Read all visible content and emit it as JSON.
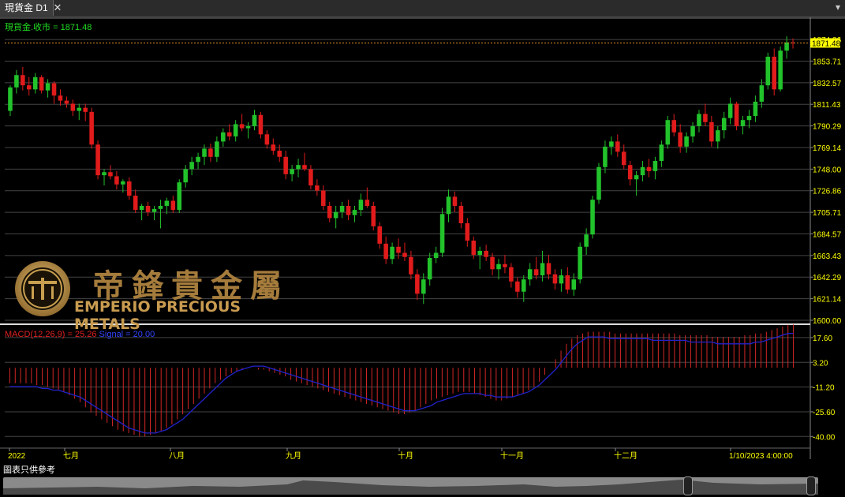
{
  "tab": {
    "title": "現貨金 D1",
    "close": "✕",
    "menu": "▾"
  },
  "legend": {
    "price": "現貨金.收市 = 1871.48",
    "macd": "MACD(12,26,9) = 25.26",
    "signal": "Signal = 20.00"
  },
  "logo": {
    "cn": "帝鋒貴金屬",
    "en": "EMPERIO PRECIOUS METALS"
  },
  "disclaimer": "圖表只供參考",
  "colors": {
    "up": "#22c22b",
    "down": "#e11b1b",
    "grid": "#444444",
    "axis_text": "#ffff00",
    "legend_price": "#22dd22",
    "macd_hist": "#d42626",
    "signal": "#2222cc",
    "last_price_line": "#e8902a"
  },
  "chart_data": [
    {
      "type": "candlestick",
      "title": "現貨金 D1",
      "ylim": [
        1600.0,
        1878.0
      ],
      "y_ticks": [
        "1874.86",
        "1853.71",
        "1832.57",
        "1811.43",
        "1790.29",
        "1769.14",
        "1748.00",
        "1726.86",
        "1705.71",
        "1684.57",
        "1663.43",
        "1642.29",
        "1621.14",
        "1600.00"
      ],
      "last_price": "1871.48",
      "x_labels": [
        "2022",
        "七月",
        "八月",
        "九月",
        "十月",
        "十一月",
        "十二月",
        "1/10/2023 4:00:00"
      ],
      "ohlc": [
        [
          1805,
          1830,
          1800,
          1828
        ],
        [
          1828,
          1845,
          1822,
          1840
        ],
        [
          1840,
          1848,
          1825,
          1830
        ],
        [
          1830,
          1838,
          1820,
          1826
        ],
        [
          1826,
          1842,
          1822,
          1838
        ],
        [
          1838,
          1840,
          1822,
          1825
        ],
        [
          1825,
          1836,
          1818,
          1832
        ],
        [
          1832,
          1834,
          1812,
          1820
        ],
        [
          1820,
          1826,
          1810,
          1815
        ],
        [
          1815,
          1819,
          1808,
          1812
        ],
        [
          1812,
          1816,
          1800,
          1805
        ],
        [
          1805,
          1812,
          1796,
          1808
        ],
        [
          1808,
          1812,
          1795,
          1804
        ],
        [
          1804,
          1808,
          1768,
          1772
        ],
        [
          1772,
          1776,
          1738,
          1742
        ],
        [
          1742,
          1748,
          1732,
          1745
        ],
        [
          1745,
          1752,
          1738,
          1741
        ],
        [
          1741,
          1746,
          1728,
          1733
        ],
        [
          1733,
          1738,
          1725,
          1736
        ],
        [
          1736,
          1740,
          1718,
          1722
        ],
        [
          1722,
          1728,
          1705,
          1708
        ],
        [
          1708,
          1714,
          1698,
          1712
        ],
        [
          1712,
          1716,
          1702,
          1706
        ],
        [
          1706,
          1712,
          1698,
          1709
        ],
        [
          1709,
          1718,
          1690,
          1712
        ],
        [
          1712,
          1720,
          1704,
          1717
        ],
        [
          1717,
          1722,
          1705,
          1708
        ],
        [
          1708,
          1738,
          1705,
          1735
        ],
        [
          1735,
          1752,
          1730,
          1748
        ],
        [
          1748,
          1760,
          1742,
          1755
        ],
        [
          1755,
          1764,
          1748,
          1760
        ],
        [
          1760,
          1772,
          1752,
          1768
        ],
        [
          1768,
          1773,
          1755,
          1760
        ],
        [
          1760,
          1780,
          1755,
          1775
        ],
        [
          1775,
          1788,
          1770,
          1784
        ],
        [
          1784,
          1792,
          1776,
          1780
        ],
        [
          1780,
          1796,
          1775,
          1792
        ],
        [
          1792,
          1802,
          1785,
          1788
        ],
        [
          1788,
          1794,
          1778,
          1790
        ],
        [
          1790,
          1806,
          1786,
          1801
        ],
        [
          1801,
          1804,
          1778,
          1782
        ],
        [
          1782,
          1786,
          1768,
          1772
        ],
        [
          1772,
          1778,
          1762,
          1766
        ],
        [
          1766,
          1772,
          1755,
          1760
        ],
        [
          1760,
          1766,
          1738,
          1743
        ],
        [
          1743,
          1752,
          1736,
          1748
        ],
        [
          1748,
          1758,
          1740,
          1752
        ],
        [
          1752,
          1764,
          1746,
          1748
        ],
        [
          1748,
          1752,
          1728,
          1732
        ],
        [
          1732,
          1738,
          1722,
          1727
        ],
        [
          1727,
          1732,
          1708,
          1712
        ],
        [
          1712,
          1716,
          1696,
          1700
        ],
        [
          1700,
          1712,
          1690,
          1706
        ],
        [
          1706,
          1716,
          1700,
          1712
        ],
        [
          1712,
          1718,
          1698,
          1703
        ],
        [
          1703,
          1712,
          1696,
          1708
        ],
        [
          1708,
          1724,
          1702,
          1718
        ],
        [
          1718,
          1730,
          1710,
          1712
        ],
        [
          1712,
          1716,
          1688,
          1692
        ],
        [
          1692,
          1696,
          1670,
          1675
        ],
        [
          1675,
          1682,
          1655,
          1660
        ],
        [
          1660,
          1676,
          1655,
          1672
        ],
        [
          1672,
          1680,
          1660,
          1666
        ],
        [
          1666,
          1676,
          1658,
          1662
        ],
        [
          1662,
          1668,
          1640,
          1645
        ],
        [
          1645,
          1650,
          1620,
          1626
        ],
        [
          1626,
          1646,
          1616,
          1640
        ],
        [
          1640,
          1666,
          1634,
          1661
        ],
        [
          1661,
          1672,
          1656,
          1666
        ],
        [
          1666,
          1710,
          1662,
          1704
        ],
        [
          1704,
          1728,
          1696,
          1721
        ],
        [
          1721,
          1726,
          1706,
          1712
        ],
        [
          1712,
          1716,
          1690,
          1695
        ],
        [
          1695,
          1700,
          1672,
          1678
        ],
        [
          1678,
          1682,
          1660,
          1664
        ],
        [
          1664,
          1672,
          1650,
          1668
        ],
        [
          1668,
          1674,
          1658,
          1662
        ],
        [
          1662,
          1666,
          1644,
          1650
        ],
        [
          1650,
          1660,
          1640,
          1655
        ],
        [
          1655,
          1664,
          1646,
          1652
        ],
        [
          1652,
          1656,
          1632,
          1638
        ],
        [
          1638,
          1642,
          1622,
          1628
        ],
        [
          1628,
          1644,
          1618,
          1640
        ],
        [
          1640,
          1656,
          1634,
          1650
        ],
        [
          1650,
          1662,
          1640,
          1644
        ],
        [
          1644,
          1668,
          1638,
          1656
        ],
        [
          1656,
          1664,
          1640,
          1645
        ],
        [
          1645,
          1650,
          1630,
          1636
        ],
        [
          1636,
          1650,
          1628,
          1644
        ],
        [
          1644,
          1652,
          1626,
          1630
        ],
        [
          1630,
          1646,
          1624,
          1640
        ],
        [
          1640,
          1676,
          1636,
          1672
        ],
        [
          1672,
          1690,
          1664,
          1684
        ],
        [
          1684,
          1722,
          1680,
          1718
        ],
        [
          1718,
          1754,
          1714,
          1750
        ],
        [
          1750,
          1776,
          1744,
          1770
        ],
        [
          1770,
          1780,
          1762,
          1775
        ],
        [
          1775,
          1782,
          1760,
          1765
        ],
        [
          1765,
          1772,
          1748,
          1752
        ],
        [
          1752,
          1756,
          1732,
          1738
        ],
        [
          1738,
          1746,
          1722,
          1742
        ],
        [
          1742,
          1756,
          1736,
          1750
        ],
        [
          1750,
          1758,
          1740,
          1746
        ],
        [
          1746,
          1760,
          1738,
          1756
        ],
        [
          1756,
          1776,
          1750,
          1772
        ],
        [
          1772,
          1800,
          1768,
          1796
        ],
        [
          1796,
          1802,
          1780,
          1784
        ],
        [
          1784,
          1792,
          1764,
          1770
        ],
        [
          1770,
          1784,
          1764,
          1780
        ],
        [
          1780,
          1794,
          1774,
          1790
        ],
        [
          1790,
          1806,
          1784,
          1802
        ],
        [
          1802,
          1812,
          1790,
          1794
        ],
        [
          1794,
          1800,
          1770,
          1775
        ],
        [
          1775,
          1790,
          1768,
          1786
        ],
        [
          1786,
          1804,
          1778,
          1798
        ],
        [
          1798,
          1818,
          1792,
          1812
        ],
        [
          1812,
          1814,
          1786,
          1790
        ],
        [
          1790,
          1800,
          1782,
          1796
        ],
        [
          1796,
          1806,
          1788,
          1800
        ],
        [
          1800,
          1820,
          1794,
          1814
        ],
        [
          1814,
          1836,
          1808,
          1830
        ],
        [
          1830,
          1862,
          1826,
          1858
        ],
        [
          1858,
          1866,
          1820,
          1826
        ],
        [
          1826,
          1868,
          1824,
          1864
        ],
        [
          1864,
          1878,
          1856,
          1872
        ],
        [
          1872,
          1876,
          1866,
          1871.48
        ]
      ]
    },
    {
      "type": "bar",
      "title": "MACD(12,26,9)",
      "ylim": [
        -44.0,
        24.0
      ],
      "y_ticks": [
        "17.60",
        "3.20",
        "-11.20",
        "-25.60",
        "-40.00"
      ],
      "series": [
        {
          "name": "MACD(12,26,9)",
          "last": 25.26,
          "values": [
            -9,
            -9,
            -9,
            -9,
            -9,
            -10,
            -10,
            -11,
            -12,
            -13,
            -14,
            -16,
            -18,
            -20,
            -23,
            -26,
            -28,
            -30,
            -32,
            -34,
            -36,
            -37,
            -38,
            -39,
            -40,
            -40,
            -39,
            -38,
            -37,
            -35,
            -33,
            -30,
            -27,
            -24,
            -21,
            -18,
            -15,
            -12,
            -9,
            -7,
            -5,
            -3,
            -2,
            -1,
            0,
            0,
            -1,
            -1,
            -2,
            -3,
            -4,
            -5,
            -7,
            -8,
            -9,
            -10,
            -11,
            -12,
            -13,
            -14,
            -15,
            -16,
            -17,
            -18,
            -19,
            -20,
            -21,
            -22,
            -23,
            -24,
            -25,
            -26,
            -27,
            -27,
            -26,
            -25,
            -23,
            -21,
            -19,
            -18,
            -17,
            -16,
            -15,
            -14,
            -14,
            -14,
            -15,
            -16,
            -17,
            -18,
            -19,
            -19,
            -18,
            -17,
            -16,
            -15,
            -13,
            -11,
            -8,
            -4,
            0,
            5,
            10,
            14,
            17,
            19,
            20,
            21,
            21,
            21,
            21,
            21,
            20,
            20,
            20,
            20,
            20,
            20,
            20,
            20,
            20,
            20,
            20,
            20,
            19,
            19,
            19,
            19,
            19,
            19,
            18,
            18,
            18,
            18,
            18,
            18,
            19,
            19,
            20,
            20,
            21,
            22,
            23,
            24,
            25,
            25.26
          ]
        },
        {
          "name": "Signal",
          "last": 20.0,
          "values": [
            -11,
            -11,
            -11,
            -11,
            -11,
            -11,
            -12,
            -12,
            -13,
            -13,
            -14,
            -15,
            -16,
            -17,
            -19,
            -21,
            -23,
            -25,
            -27,
            -29,
            -31,
            -33,
            -35,
            -36,
            -37,
            -38,
            -38,
            -38,
            -37,
            -36,
            -34,
            -32,
            -30,
            -27,
            -24,
            -21,
            -18,
            -15,
            -12,
            -9,
            -6,
            -4,
            -2,
            -1,
            0,
            1,
            1,
            1,
            0,
            -1,
            -2,
            -3,
            -4,
            -5,
            -6,
            -7,
            -8,
            -9,
            -10,
            -11,
            -12,
            -13,
            -14,
            -15,
            -16,
            -17,
            -18,
            -19,
            -20,
            -21,
            -22,
            -23,
            -24,
            -25,
            -25,
            -25,
            -24,
            -23,
            -22,
            -20,
            -19,
            -18,
            -17,
            -16,
            -15,
            -15,
            -15,
            -15,
            -16,
            -16,
            -17,
            -17,
            -17,
            -17,
            -16,
            -15,
            -14,
            -12,
            -10,
            -7,
            -4,
            -1,
            3,
            7,
            11,
            14,
            16,
            18,
            18,
            18,
            18,
            17,
            17,
            17,
            17,
            17,
            17,
            17,
            17,
            16,
            16,
            16,
            16,
            16,
            16,
            16,
            15,
            15,
            15,
            15,
            15,
            14,
            14,
            14,
            14,
            14,
            14,
            14,
            15,
            15,
            16,
            17,
            18,
            19,
            20,
            20
          ]
        }
      ]
    }
  ]
}
